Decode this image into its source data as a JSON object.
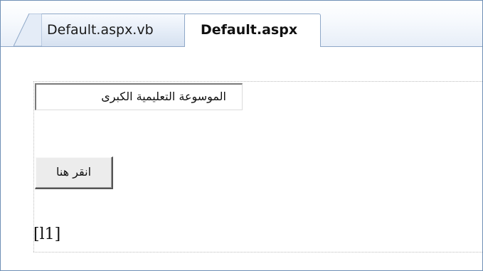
{
  "tabs": [
    {
      "label": "Default.aspx.vb",
      "active": false
    },
    {
      "label": "Default.aspx",
      "active": true
    }
  ],
  "design": {
    "textbox_value": "الموسوعة التعليمية الكبرى",
    "button_label": "انقر هنا",
    "label_text": "[l1]"
  },
  "colors": {
    "tab_border": "#8fa8c8",
    "frame_border": "#6f8fb5",
    "guide_dots": "#bcbcbc",
    "button_face": "#ececec"
  }
}
